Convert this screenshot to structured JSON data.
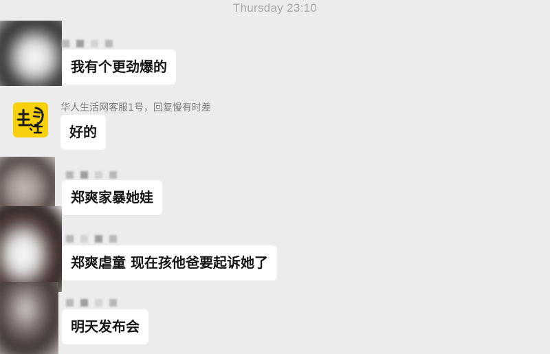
{
  "header": {
    "timestamp": "Thursday 23:10"
  },
  "messages": [
    {
      "text": "我有个更劲爆的",
      "sender_visible": false
    },
    {
      "text": "好的",
      "sender": "华人生活网客服1号，回复慢有时差",
      "avatar_icon": "huaren-life-logo-icon"
    },
    {
      "text": "郑爽家暴她娃",
      "sender_visible": false
    },
    {
      "text": "郑爽虐童 现在孩他爸要起诉她了",
      "sender_visible": false
    },
    {
      "text": "明天发布会",
      "sender_visible": false
    }
  ],
  "colors": {
    "background": "#ececec",
    "bubble": "#ffffff",
    "text": "#151515",
    "timestamp": "#a7a7a7",
    "logo": "#f8d00c"
  }
}
